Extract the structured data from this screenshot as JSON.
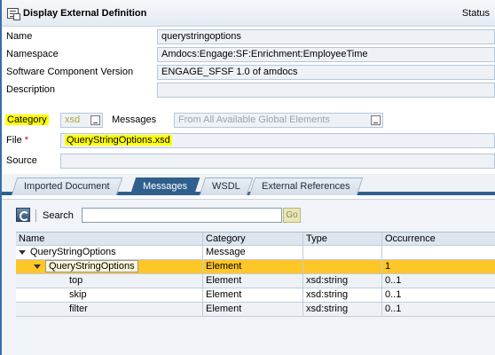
{
  "title": "Display External Definition",
  "status_label": "Status",
  "form": {
    "name_label": "Name",
    "name_value": "querystringoptions",
    "namespace_label": "Namespace",
    "namespace_value": "Amdocs:Engage:SF:Enrichment:EmployeeTime",
    "swcv_label": "Software Component Version",
    "swcv_value": "ENGAGE_SFSF 1.0 of amdocs",
    "description_label": "Description",
    "description_value": "",
    "category_label": "Category",
    "category_value": "xsd",
    "messages_label": "Messages",
    "messages_value": "From All Available Global Elements",
    "file_label": "File",
    "file_required": "*",
    "file_value": "QueryStringOptions.xsd",
    "source_label": "Source",
    "source_value": ""
  },
  "tabs": [
    {
      "label": "Imported Document",
      "active": false
    },
    {
      "label": "Messages",
      "active": true
    },
    {
      "label": "WSDL",
      "active": false
    },
    {
      "label": "External References",
      "active": false
    }
  ],
  "toolbar": {
    "search_label": "Search",
    "search_value": "",
    "go_label": "Go"
  },
  "table": {
    "columns": [
      "Name",
      "Category",
      "Type",
      "Occurrence"
    ],
    "rows": [
      {
        "name": "QueryStringOptions",
        "category": "Message",
        "type": "",
        "occurrence": ""
      },
      {
        "name": "QueryStringOptions",
        "category": "Element",
        "type": "",
        "occurrence": "1"
      },
      {
        "name": "top",
        "category": "Element",
        "type": "xsd:string",
        "occurrence": "0..1"
      },
      {
        "name": "skip",
        "category": "Element",
        "type": "xsd:string",
        "occurrence": "0..1"
      },
      {
        "name": "filter",
        "category": "Element",
        "type": "xsd:string",
        "occurrence": "0..1"
      }
    ]
  },
  "colors": {
    "selected_row": "#ffc628",
    "highlight": "#ffff00",
    "active_tab": "#2f5f8f"
  }
}
